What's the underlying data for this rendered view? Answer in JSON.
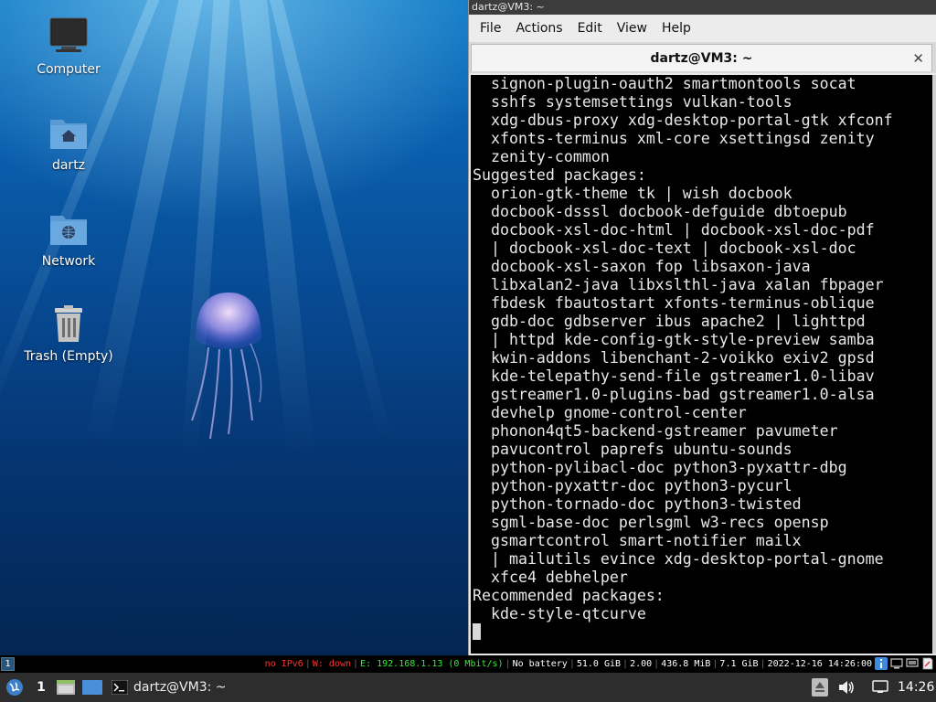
{
  "desktop": {
    "icons": [
      {
        "label": "Computer"
      },
      {
        "label": "dartz"
      },
      {
        "label": "Network"
      },
      {
        "label": "Trash (Empty)"
      }
    ]
  },
  "terminal": {
    "window_title": "dartz@VM3: ~",
    "menu": [
      "File",
      "Actions",
      "Edit",
      "View",
      "Help"
    ],
    "tab_title": "dartz@VM3: ~",
    "lines": [
      "  signon-plugin-oauth2 smartmontools socat",
      "  sshfs systemsettings vulkan-tools",
      "  xdg-dbus-proxy xdg-desktop-portal-gtk xfconf",
      "  xfonts-terminus xml-core xsettingsd zenity",
      "  zenity-common",
      "Suggested packages:",
      "  orion-gtk-theme tk | wish docbook",
      "  docbook-dsssl docbook-defguide dbtoepub",
      "  docbook-xsl-doc-html | docbook-xsl-doc-pdf",
      "  | docbook-xsl-doc-text | docbook-xsl-doc",
      "  docbook-xsl-saxon fop libsaxon-java",
      "  libxalan2-java libxslthl-java xalan fbpager",
      "  fbdesk fbautostart xfonts-terminus-oblique",
      "  gdb-doc gdbserver ibus apache2 | lighttpd",
      "  | httpd kde-config-gtk-style-preview samba",
      "  kwin-addons libenchant-2-voikko exiv2 gpsd",
      "  kde-telepathy-send-file gstreamer1.0-libav",
      "  gstreamer1.0-plugins-bad gstreamer1.0-alsa",
      "  devhelp gnome-control-center",
      "  phonon4qt5-backend-gstreamer pavumeter",
      "  pavucontrol paprefs ubuntu-sounds",
      "  python-pylibacl-doc python3-pyxattr-dbg",
      "  python-pyxattr-doc python3-pycurl",
      "  python-tornado-doc python3-twisted",
      "  sgml-base-doc perlsgml w3-recs opensp",
      "  gsmartcontrol smart-notifier mailx",
      "  | mailutils evince xdg-desktop-portal-gnome",
      "  xfce4 debhelper",
      "Recommended packages:",
      "  kde-style-qtcurve"
    ]
  },
  "statusbar": {
    "workspace": "1",
    "items": [
      {
        "text": "no IPv6",
        "color": "#ff3030"
      },
      {
        "text": "W: down",
        "color": "#ff3030"
      },
      {
        "text": "E: 192.168.1.13 (0 Mbit/s)",
        "color": "#33ee33"
      },
      {
        "text": "No battery",
        "color": "#ffffff"
      },
      {
        "text": "51.0 GiB",
        "color": "#ffffff"
      },
      {
        "text": "2.00",
        "color": "#ffffff"
      },
      {
        "text": "436.8 MiB",
        "color": "#ffffff"
      },
      {
        "text": "7.1 GiB",
        "color": "#ffffff"
      },
      {
        "text": "2022-12-16 14:26:00",
        "color": "#ffffff"
      }
    ]
  },
  "taskbar": {
    "workspace": "1",
    "task_label": "dartz@VM3: ~",
    "clock": "14:26"
  },
  "colors": {
    "accent": "#285577",
    "terminal_bg": "#000000",
    "terminal_fg": "#e8e8e8"
  }
}
